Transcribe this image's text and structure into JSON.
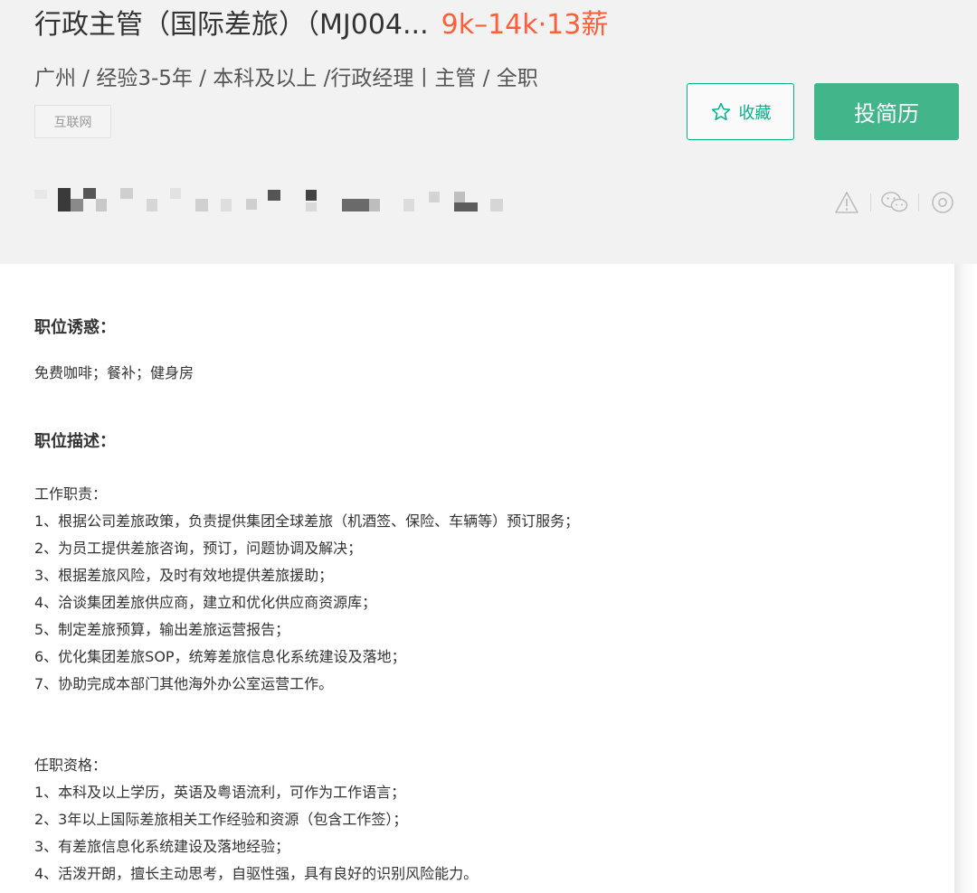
{
  "job": {
    "title": "行政主管（国际差旅）（MJ004...",
    "salary": "9k–14k·13薪",
    "meta": "广州 / 经验3-5年 / 本科及以上 /行政经理丨主管 / 全职",
    "tag": "互联网"
  },
  "actions": {
    "favorite_label": "收藏",
    "apply_label": "投简历"
  },
  "sections": {
    "perks_title": "职位诱惑：",
    "perks_text": "免费咖啡；餐补；健身房",
    "desc_title": "职位描述："
  },
  "description": {
    "duties_heading": "工作职责：",
    "duties": [
      "1、根据公司差旅政策，负责提供集团全球差旅（机酒签、保险、车辆等）预订服务；",
      "2、为员工提供差旅咨询，预订，问题协调及解决；",
      "3、根据差旅风险，及时有效地提供差旅援助；",
      "4、洽谈集团差旅供应商，建立和优化供应商资源库；",
      "5、制定差旅预算，输出差旅运营报告；",
      "6、优化集团差旅SOP，统筹差旅信息化系统建设及落地；",
      "7、协助完成本部门其他海外办公室运营工作。"
    ],
    "requirements_heading": "任职资格：",
    "requirements": [
      "1、本科及以上学历，英语及粤语流利，可作为工作语言；",
      "2、3年以上国际差旅相关工作经验和资源（包含工作签）；",
      "3、有差旅信息化系统建设及落地经验；",
      "4、活泼开朗，擅长主动思考，自驱性强，具有良好的识别风险能力。"
    ]
  },
  "colors": {
    "accent_green": "#00b38a",
    "apply_green": "#42b58a",
    "salary_orange": "#fd5f39"
  },
  "icons": {
    "favorite": "star-icon",
    "share": [
      "warning-icon",
      "wechat-icon",
      "weibo-icon"
    ]
  }
}
